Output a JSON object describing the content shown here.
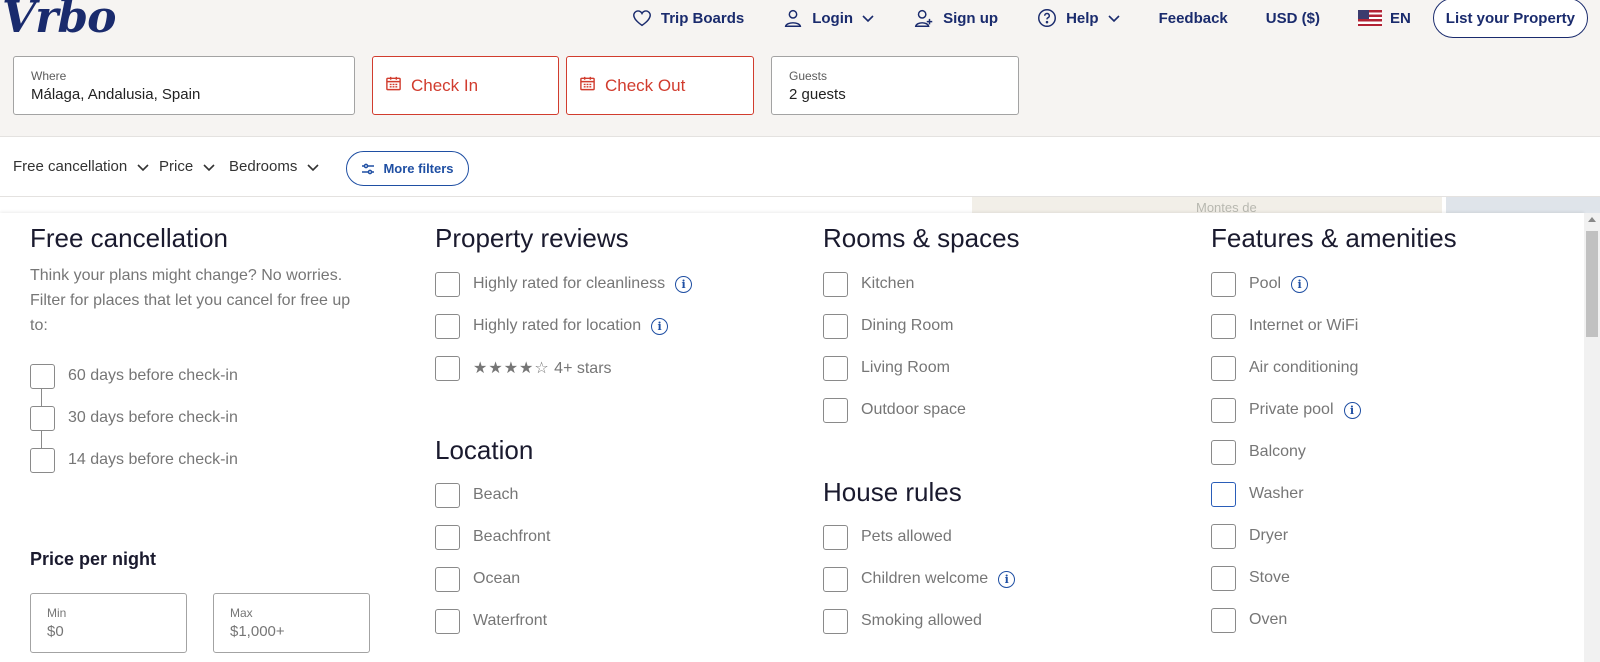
{
  "brand": {
    "logo_text": "Vrbo"
  },
  "topnav": {
    "trip_boards": "Trip Boards",
    "login": "Login",
    "sign_up": "Sign up",
    "help": "Help",
    "feedback": "Feedback",
    "currency": "USD ($)",
    "language": "EN",
    "list_property": "List your Property"
  },
  "search": {
    "where_label": "Where",
    "where_value": "Málaga, Andalusia, Spain",
    "check_in": "Check In",
    "check_out": "Check Out",
    "guests_label": "Guests",
    "guests_value": "2 guests"
  },
  "filterbar": {
    "free_cancellation": "Free cancellation",
    "price": "Price",
    "bedrooms": "Bedrooms",
    "more_filters": "More filters"
  },
  "map": {
    "place_label": "Montes de"
  },
  "panel": {
    "free_cancellation": {
      "title": "Free cancellation",
      "description": "Think your plans might change? No worries. Filter for places that let you cancel for free up to:",
      "options": [
        "60 days before check-in",
        "30 days before check-in",
        "14 days before check-in"
      ]
    },
    "price": {
      "title": "Price per night",
      "min_label": "Min",
      "min_value": "$0",
      "max_label": "Max",
      "max_value": "$1,000+"
    },
    "property_reviews": {
      "title": "Property reviews",
      "options": [
        "Highly rated for cleanliness",
        "Highly rated for location",
        "4+ stars"
      ],
      "stars_glyph": "★★★★☆"
    },
    "location": {
      "title": "Location",
      "options": [
        "Beach",
        "Beachfront",
        "Ocean",
        "Waterfront"
      ]
    },
    "rooms_spaces": {
      "title": "Rooms & spaces",
      "options": [
        "Kitchen",
        "Dining Room",
        "Living Room",
        "Outdoor space"
      ]
    },
    "house_rules": {
      "title": "House rules",
      "options": [
        "Pets allowed",
        "Children welcome",
        "Smoking allowed"
      ]
    },
    "features": {
      "title": "Features & amenities",
      "options": [
        "Pool",
        "Internet or WiFi",
        "Air conditioning",
        "Private pool",
        "Balcony",
        "Washer",
        "Dryer",
        "Stove",
        "Oven"
      ]
    },
    "info_glyph": "i"
  },
  "colors": {
    "brand_navy": "#1a2b6d",
    "accent_blue": "#1f4fa3",
    "error_red": "#d13c2e"
  }
}
